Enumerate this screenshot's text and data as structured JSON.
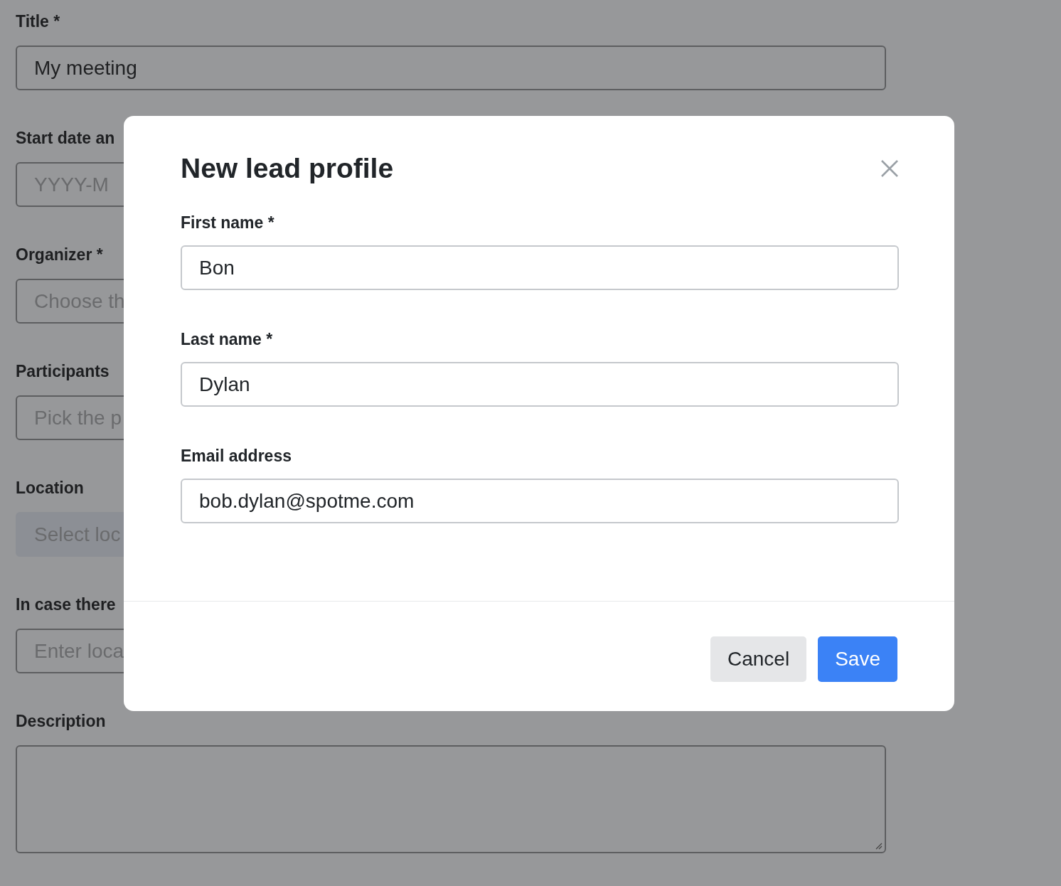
{
  "form": {
    "fields": [
      {
        "label": "Title *",
        "kind": "input",
        "value": "My meeting",
        "disabled": false
      },
      {
        "label": "Start date an",
        "kind": "input",
        "placeholder": "YYYY-M",
        "disabled": false
      },
      {
        "label": "Organizer *",
        "kind": "input",
        "placeholder": "Choose th",
        "disabled": false
      },
      {
        "label": "Participants",
        "kind": "input",
        "placeholder": "Pick the p",
        "disabled": false
      },
      {
        "label": "Location",
        "kind": "input",
        "placeholder": "Select loc",
        "disabled": true
      },
      {
        "label": "In case there",
        "kind": "input",
        "placeholder": "Enter loca",
        "disabled": false
      },
      {
        "label": "Description",
        "kind": "textarea"
      }
    ]
  },
  "modal": {
    "title": "New lead profile",
    "fields": [
      {
        "label": "First name *",
        "value": "Bon"
      },
      {
        "label": "Last name *",
        "value": "Dylan"
      },
      {
        "label": "Email address",
        "value": "bob.dylan@spotme.com"
      }
    ],
    "buttons": [
      {
        "label": "Cancel",
        "kind": "secondary"
      },
      {
        "label": "Save",
        "kind": "primary"
      }
    ]
  }
}
